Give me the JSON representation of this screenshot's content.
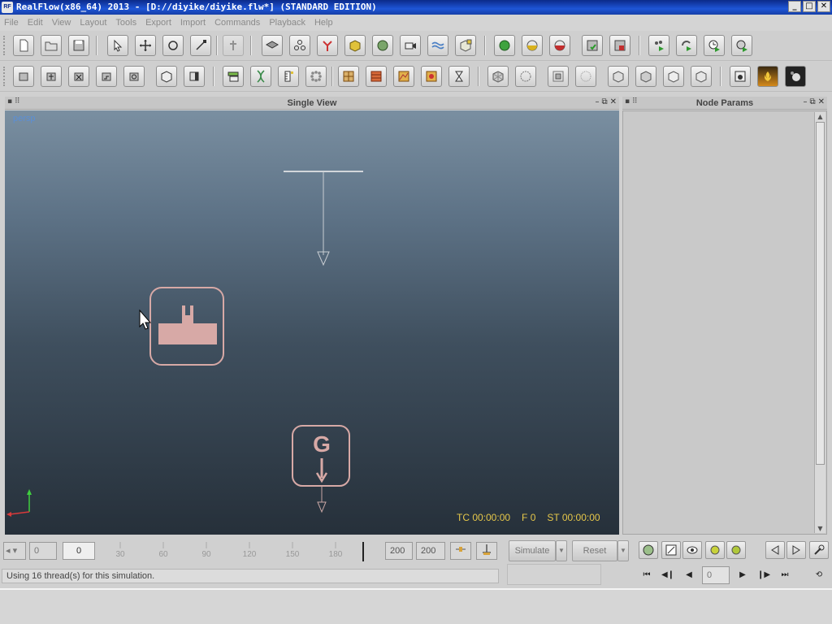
{
  "window": {
    "app_icon_text": "RF",
    "title": "RealFlow(x86_64) 2013 - [D://diyike/diyike.flw*] (STANDARD EDITION)",
    "minimize": "_",
    "maximize": "□",
    "close": "✕"
  },
  "menu": [
    "File",
    "Edit",
    "View",
    "Layout",
    "Tools",
    "Export",
    "Import",
    "Commands",
    "Playback",
    "Help"
  ],
  "toolbar1_icons": [
    "new-file-icon",
    "open-folder-icon",
    "save-icon",
    "select-arrow-icon",
    "move-icon",
    "rotate-icon",
    "scale-icon",
    "pin-icon",
    "layers-icon",
    "nodes-icon",
    "fork-icon",
    "box-icon",
    "sphere-icon",
    "camera-icon",
    "waves-icon",
    "mesh-cube-icon",
    "green-dot-icon",
    "yellow-dot-icon",
    "red-dot-icon",
    "save-green-icon",
    "save-red-icon",
    "simulate-play-icon",
    "loop-play-icon",
    "clock-play-icon",
    "globe-play-icon"
  ],
  "toolbar2_icons": [
    "emitter-square-icon",
    "emitter-plus-icon",
    "emitter-x-icon",
    "emitter-step-icon",
    "emitter-circle-icon",
    "object-cube-icon",
    "object-cylinder-icon",
    "daemon-icon",
    "dna-icon",
    "ruler-icon",
    "particles-icon",
    "grid-yellow-icon",
    "grid-red-icon",
    "grid-map-icon",
    "grid-flower-icon",
    "hourglass-icon",
    "mesh-a-icon",
    "mesh-b-icon",
    "mesh-c-icon",
    "mesh-d-icon",
    "cube-a-icon",
    "cube-b-icon",
    "cube-c-icon",
    "cube-d-icon",
    "render-icon",
    "fire-icon",
    "dark-render-icon"
  ],
  "viewport": {
    "panel_title": "Single View",
    "camera_label": "persp",
    "gravity_letter": "G",
    "hud": {
      "tc": "TC 00:00:00",
      "frame": "F 0",
      "st": "ST 00:00:00"
    }
  },
  "params": {
    "panel_title": "Node Params"
  },
  "timeline": {
    "start": "0",
    "current": "0",
    "ticks": [
      "30",
      "60",
      "90",
      "120",
      "150",
      "180"
    ],
    "end_a": "200",
    "end_b": "200"
  },
  "buttons": {
    "simulate": "Simulate",
    "reset": "Reset"
  },
  "status": {
    "message": "Using 16 thread(s) for this simulation."
  },
  "playback": {
    "frame": "0"
  },
  "colors": {
    "hud": "#e6c84a",
    "persp": "#5b8fd6",
    "object_outline": "#d7a9a6"
  }
}
